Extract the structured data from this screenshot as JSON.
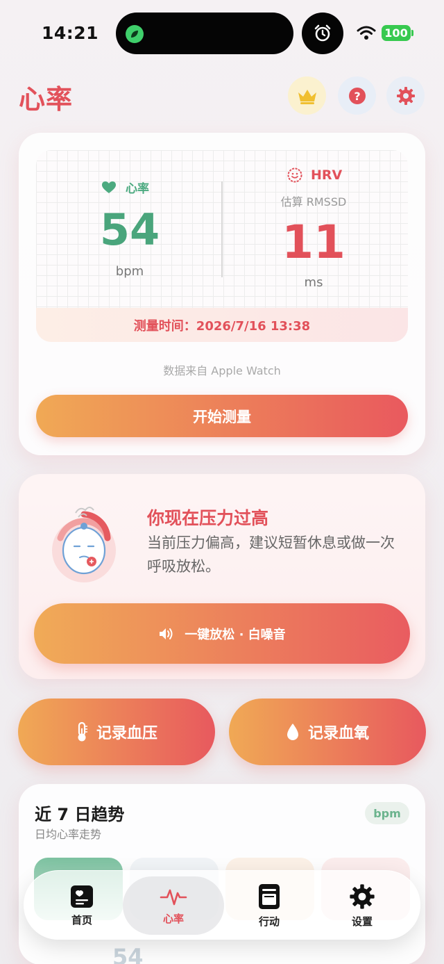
{
  "status_bar": {
    "time": "14:21",
    "battery": "100"
  },
  "header": {
    "title": "心率"
  },
  "heart_card": {
    "hr_label": "心率",
    "hr_value": "54",
    "hr_unit": "bpm",
    "hrv_label": "HRV",
    "hrv_sub": "估算 RMSSD",
    "hrv_value": "11",
    "hrv_unit": "ms",
    "measure_time": "测量时间：2026/7/16 13:38",
    "source": "数据来自 Apple Watch",
    "start_button": "开始测量"
  },
  "stress_card": {
    "title": "你现在压力过高",
    "description": "当前压力偏高，建议短暂休息或做一次呼吸放松。",
    "relax_button": "一键放松 · 白噪音"
  },
  "record": {
    "blood_pressure": "记录血压",
    "blood_oxygen": "记录血氧"
  },
  "trend_card": {
    "title": "近 7 日趋势",
    "subtitle": "日均心率走势",
    "unit_badge": "bpm",
    "peek_value": "54"
  },
  "tab_bar": {
    "items": [
      {
        "label": "首页",
        "icon": "home-card-icon"
      },
      {
        "label": "心率",
        "icon": "pulse-icon"
      },
      {
        "label": "行动",
        "icon": "notebook-icon"
      },
      {
        "label": "设置",
        "icon": "gear-icon"
      }
    ],
    "active": "心率"
  },
  "colors": {
    "accent_red": "#e2515a",
    "accent_green": "#4aa57c",
    "gradient_start": "#f0a955",
    "gradient_end": "#e9595e"
  }
}
